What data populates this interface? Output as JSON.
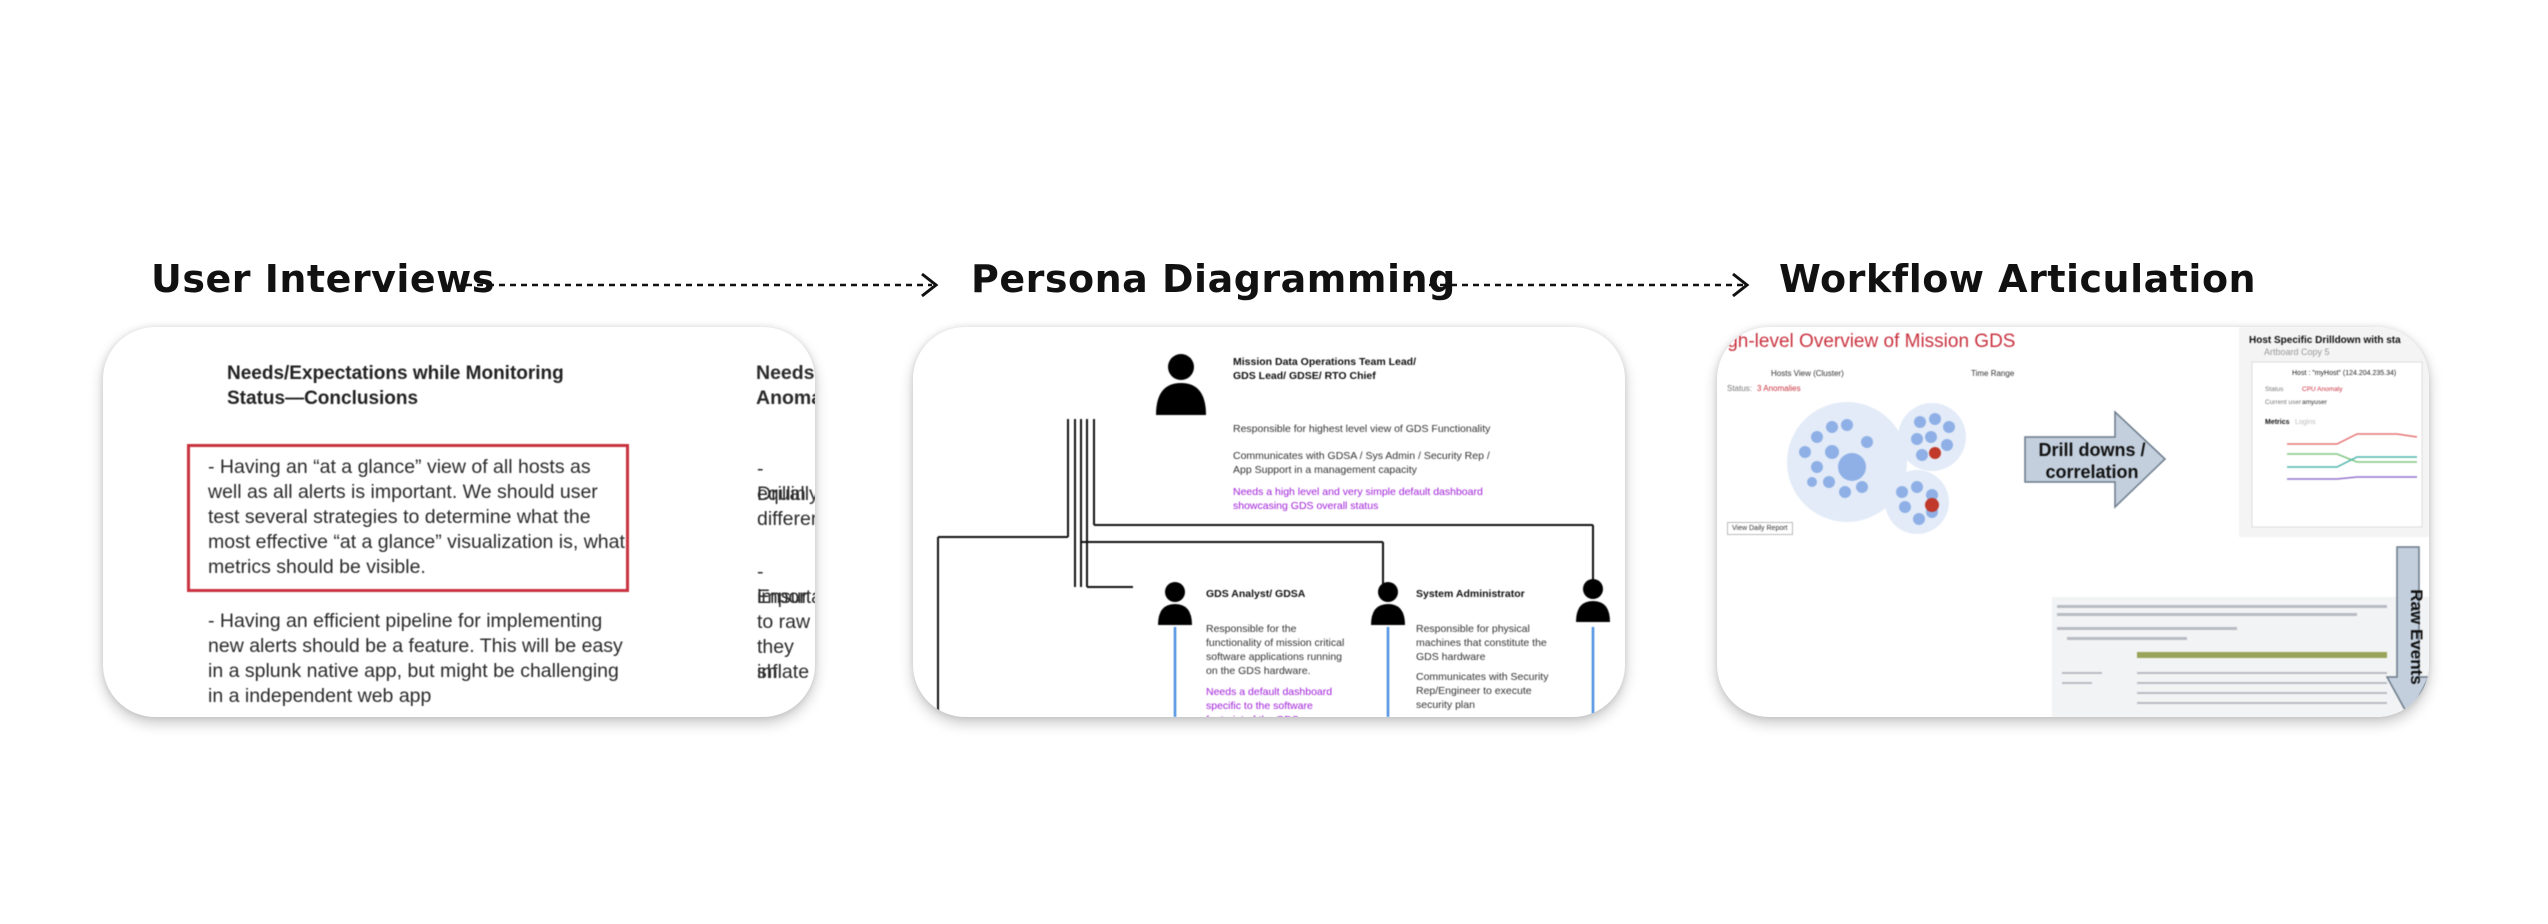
{
  "steps": [
    {
      "title": "User Interviews"
    },
    {
      "title": "Persona Diagramming"
    },
    {
      "title": "Workflow Articulation"
    }
  ],
  "interviews": {
    "heading": "Needs/Expectations while Monitoring Status—Conclusions",
    "heading_clipped": "Needs,",
    "heading_clipped_2": "Anoma",
    "boxed_note": "- Having an “at a glance” view of all hosts as well as all alerts is important. We should user test several strategies to determine what the most effective “at a glance” visualization is, what metrics should be visible.",
    "note_2": "- Having an efficient pipeline for implementing new alerts should be a feature. This will be easy in a splunk native app, but might be challenging in a independent web app",
    "clipped_lines_a": [
      "- Drillin",
      "equally",
      "differen"
    ],
    "clipped_lines_b": [
      "- Ensur",
      "importa",
      "to raw",
      "they sh",
      "inflate"
    ]
  },
  "personas": {
    "lead": {
      "title": "Mission Data Operations Team Lead/ GDS Lead/ GDSE/ RTO Chief",
      "desc_1": "Responsible for highest level view of GDS Functionality",
      "desc_2": "Communicates with GDSA / Sys Admin / Security Rep / App Support in a management capacity",
      "need": "Needs a high level and very simple default dashboard showcasing GDS overall status"
    },
    "analyst": {
      "title": "GDS Analyst/ GDSA",
      "desc_1": "Responsible for the functionality of mission critical software applications running on the GDS hardware.",
      "need": "Needs a default dashboard specific to the software footprint of the GDS"
    },
    "sysadmin": {
      "title": "System Administrator",
      "desc_1": "Responsible for physical machines that constitute the GDS hardware",
      "desc_2": "Communicates with Security Rep/Engineer to execute security plan"
    }
  },
  "workflow": {
    "overview_title": "igh-level Overview of Mission GDS",
    "view_label": "Hosts View (Cluster)",
    "time_range": "Time Range",
    "status_label": "Status:",
    "status_value": "3 Anomalies",
    "view_report": "View Daily Report",
    "drill_label": "Drill downs / correlation",
    "raw_label": "Raw Events",
    "host_title": "Host Specific Drilldown with sta",
    "artboard": "Artboard Copy 5",
    "host_value": "Host : \"myHost\" (124.204.235.34)",
    "status_field": "Status",
    "status_field_value": "CPU Anomaly",
    "current_user": "Current user",
    "current_user_value": "amyuser",
    "metrics_tab": "Metrics",
    "logins_tab": "Logins",
    "colors": {
      "red": "#c9323f",
      "purple": "#a020d8",
      "blue_line": "#4a90e2",
      "bubble": "#8fb0e6",
      "anomaly": "#c0392b",
      "arrow_fill": "#c3cfdd"
    }
  }
}
